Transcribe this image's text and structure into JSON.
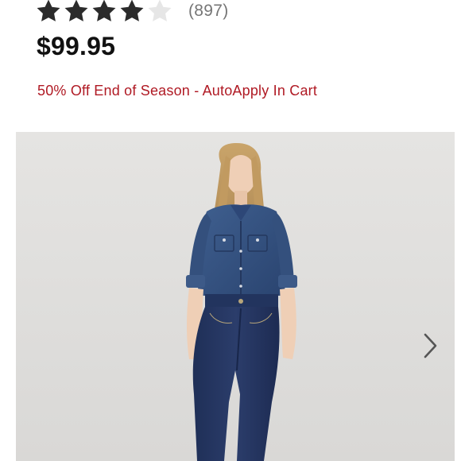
{
  "product": {
    "rating": {
      "stars_filled": 4,
      "stars_total": 5,
      "review_count": "(897)"
    },
    "price": "$99.95",
    "promo": "50% Off End of Season - AutoApply In Cart",
    "carousel": {
      "next_icon": "chevron-right-icon"
    }
  },
  "colors": {
    "star_filled": "#2b2b2b",
    "star_empty": "#e6e6e6",
    "promo": "#b01a24",
    "image_bg": "#e2e1df"
  }
}
